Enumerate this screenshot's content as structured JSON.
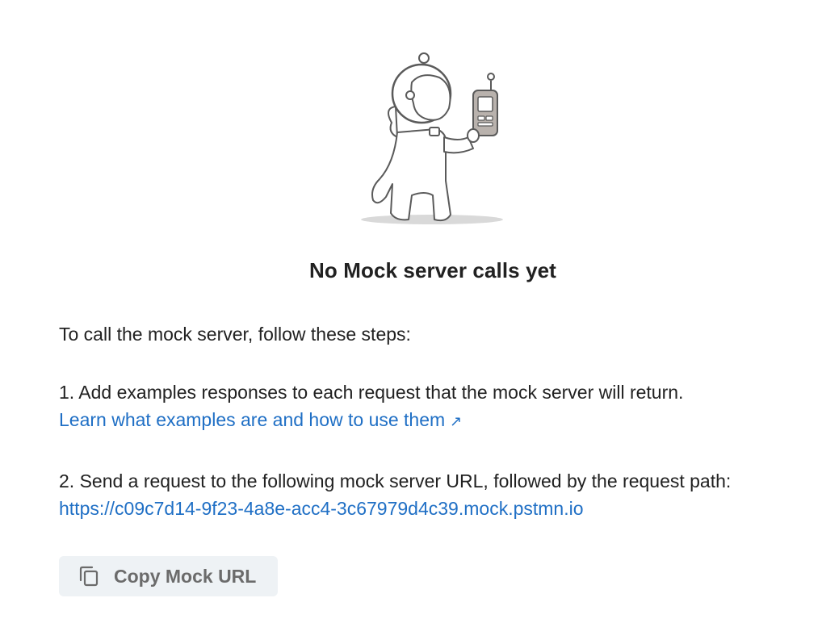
{
  "empty_state": {
    "title": "No Mock server calls yet",
    "intro": "To call the mock server, follow these steps:",
    "step1": {
      "text": "1. Add examples responses to each request that the mock server will return.",
      "link_label": "Learn what examples are and how to use them",
      "link_icon": "external-link-arrow-icon",
      "link_arrow_glyph": "↗"
    },
    "step2": {
      "text": "2. Send a request to the following mock server URL, followed by the request path:",
      "mock_url": "https://c09c7d14-9f23-4a8e-acc4-3c67979d4c39.mock.pstmn.io"
    },
    "copy_button": {
      "label": "Copy Mock URL",
      "icon": "copy-icon"
    },
    "illustration": "astronaut-with-walkie-talkie"
  },
  "colors": {
    "link": "#1f6fc5",
    "text": "#212121",
    "button_bg": "#eef2f5",
    "button_text": "#6b6b6b"
  }
}
